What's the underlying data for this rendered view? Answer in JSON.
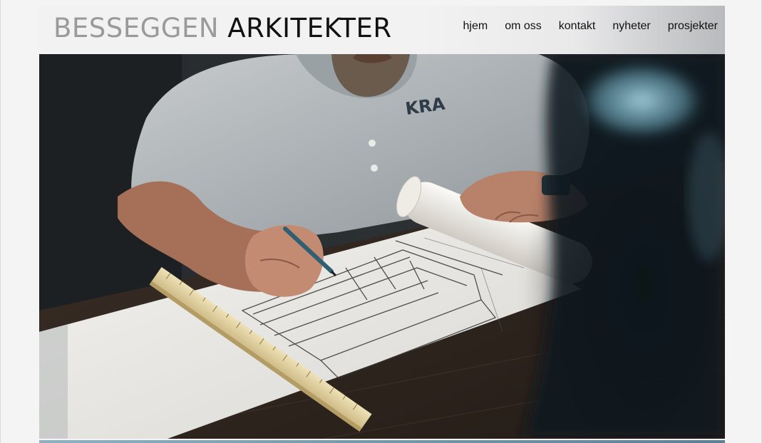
{
  "site": {
    "logo_light": "BESSEGGEN",
    "logo_dark": "ARKITEKTER"
  },
  "nav": {
    "items": [
      {
        "label": "hjem"
      },
      {
        "label": "om oss"
      },
      {
        "label": "kontakt"
      },
      {
        "label": "nyheter"
      },
      {
        "label": "prosjekter"
      }
    ]
  },
  "hero": {
    "shirt_logo": "KRA"
  }
}
